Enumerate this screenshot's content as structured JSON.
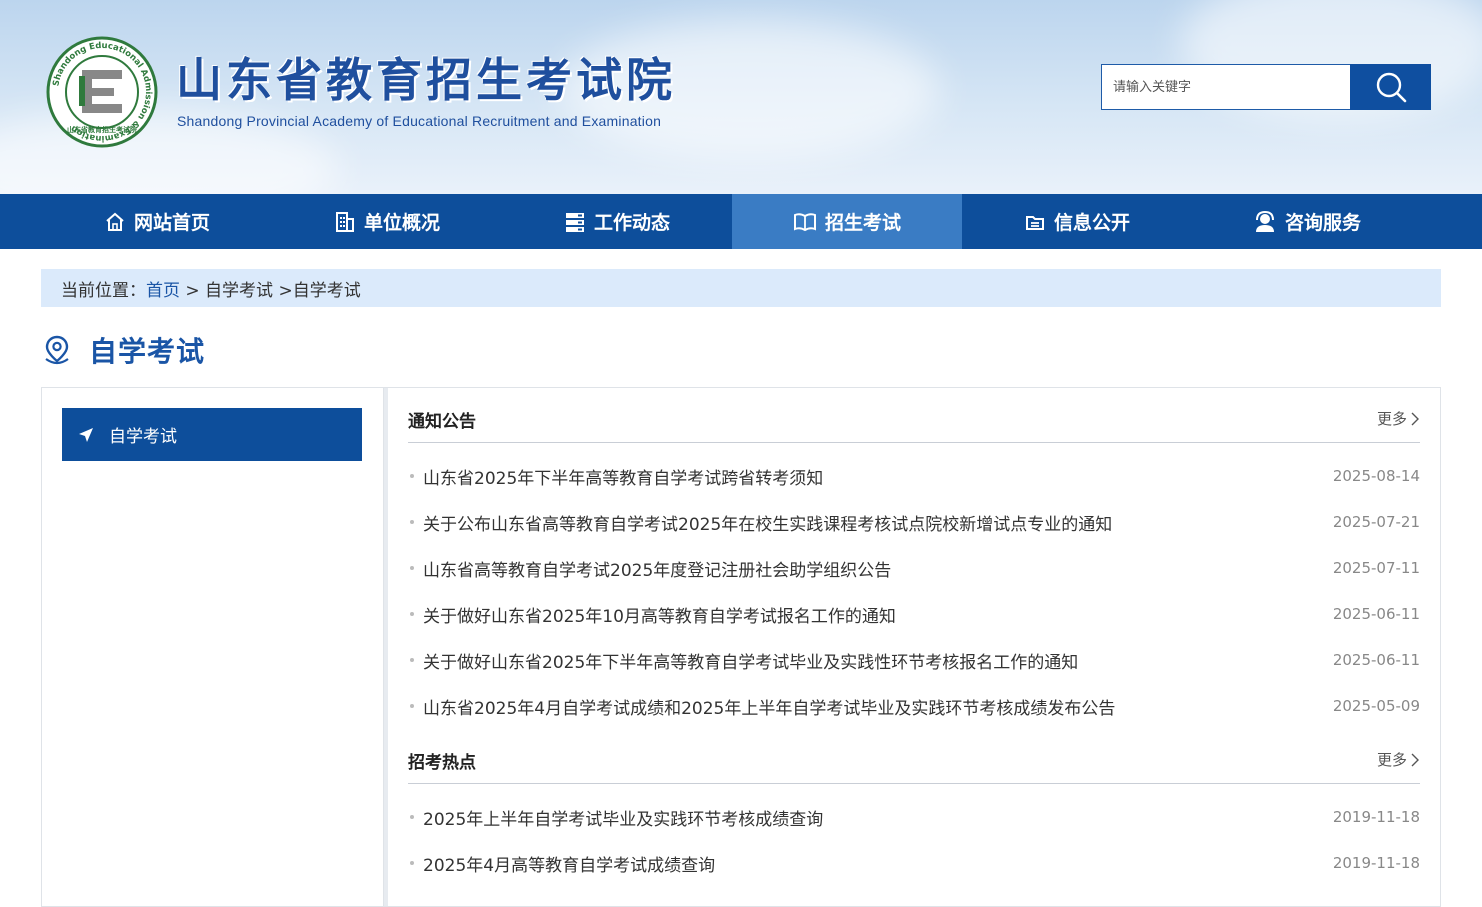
{
  "header": {
    "title": "山东省教育招生考试院",
    "subtitle": "Shandong Provincial Academy of Educational Recruitment and Examination",
    "logo_ring_text": "Shandong Educational Admission & Examination",
    "logo_cn_text": "山东省教育招生考试院",
    "search": {
      "placeholder": "请输入关键字",
      "value": ""
    }
  },
  "nav": {
    "items": [
      {
        "label": "网站首页",
        "icon": "home-icon"
      },
      {
        "label": "单位概况",
        "icon": "building-icon"
      },
      {
        "label": "工作动态",
        "icon": "server-icon"
      },
      {
        "label": "招生考试",
        "icon": "book-icon",
        "active": true
      },
      {
        "label": "信息公开",
        "icon": "folder-icon"
      },
      {
        "label": "咨询服务",
        "icon": "support-icon"
      }
    ]
  },
  "breadcrumb": {
    "prefix": "当前位置：",
    "home": "首页",
    "level1": " > 自学考试",
    "level2": " >自学考试"
  },
  "page": {
    "heading": "自学考试"
  },
  "sidebar": {
    "items": [
      {
        "label": "自学考试"
      }
    ]
  },
  "sections": [
    {
      "title": "通知公告",
      "more": "更多",
      "items": [
        {
          "title": "山东省2025年下半年高等教育自学考试跨省转考须知",
          "date": "2025-08-14"
        },
        {
          "title": "关于公布山东省高等教育自学考试2025年在校生实践课程考核试点院校新增试点专业的通知",
          "date": "2025-07-21"
        },
        {
          "title": "山东省高等教育自学考试2025年度登记注册社会助学组织公告",
          "date": "2025-07-11"
        },
        {
          "title": "关于做好山东省2025年10月高等教育自学考试报名工作的通知",
          "date": "2025-06-11"
        },
        {
          "title": "关于做好山东省2025年下半年高等教育自学考试毕业及实践性环节考核报名工作的通知",
          "date": "2025-06-11"
        },
        {
          "title": "山东省2025年4月自学考试成绩和2025年上半年自学考试毕业及实践环节考核成绩发布公告",
          "date": "2025-05-09"
        }
      ]
    },
    {
      "title": "招考热点",
      "more": "更多",
      "items": [
        {
          "title": "2025年上半年自学考试毕业及实践环节考核成绩查询",
          "date": "2019-11-18"
        },
        {
          "title": "2025年4月高等教育自学考试成绩查询",
          "date": "2019-11-18"
        }
      ]
    }
  ]
}
